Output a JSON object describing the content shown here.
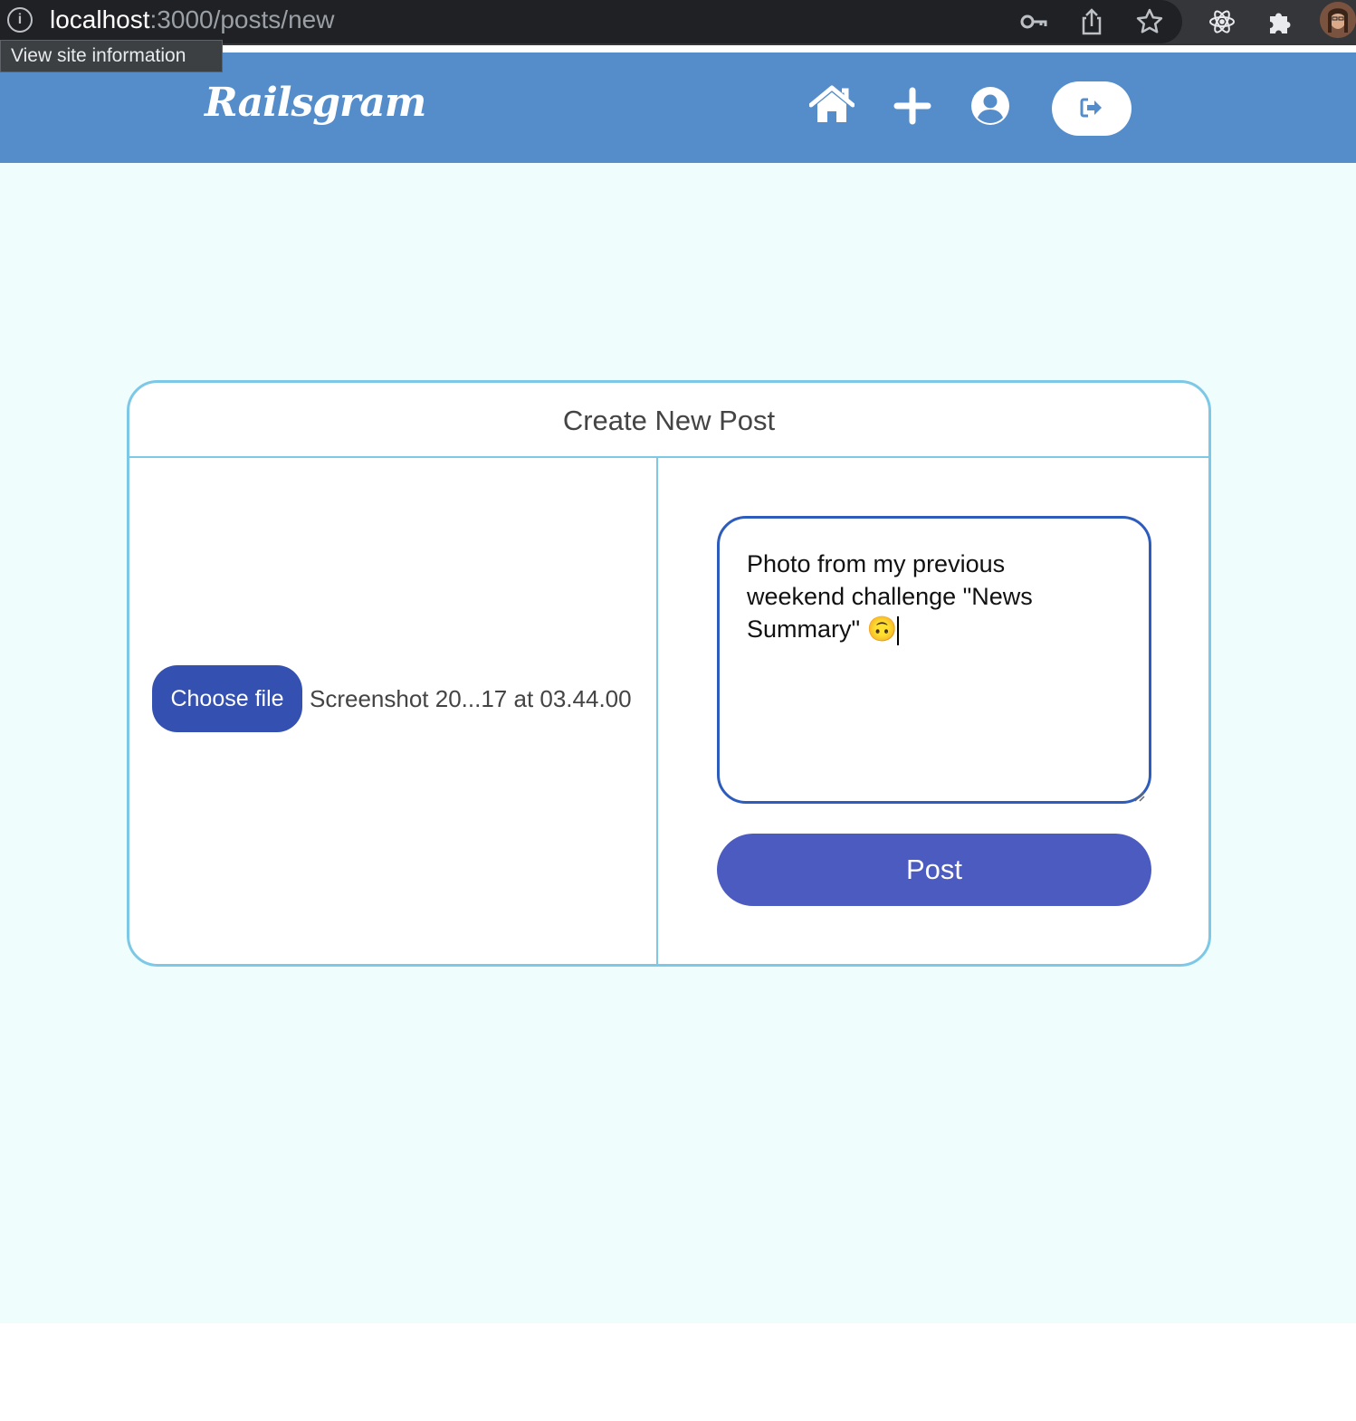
{
  "browser": {
    "url_host": "localhost",
    "url_path": ":3000/posts/new",
    "tooltip": "View site information"
  },
  "navbar": {
    "brand": "Railsgram",
    "icons": [
      "home-icon",
      "plus-icon",
      "user-circle-icon",
      "sign-out-icon"
    ],
    "color": "#558dcb"
  },
  "form": {
    "title": "Create New Post",
    "file_button": "Choose file",
    "file_name": "Screenshot 20...17 at 03.44.00",
    "caption_line1": "Photo from my previous",
    "caption_line2": "weekend challenge \"News",
    "caption_line3": "Summary\"",
    "caption_emoji": "🙃",
    "submit_label": "Post"
  },
  "colors": {
    "page_bg": "#effdfc",
    "card_border": "#7cc8e6",
    "file_button": "#3451b2",
    "post_button": "#4b5bbf"
  }
}
